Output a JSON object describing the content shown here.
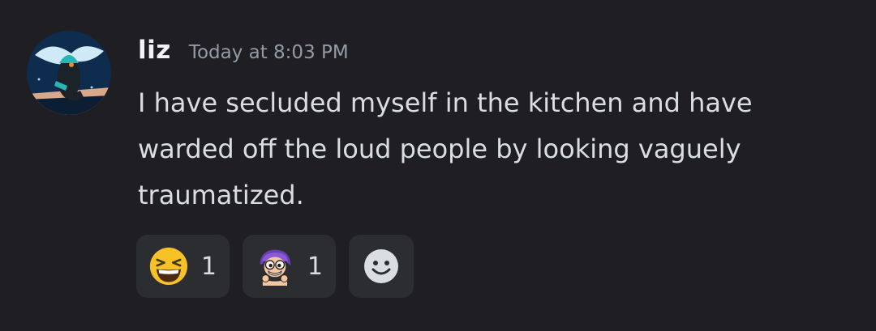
{
  "message": {
    "author": "liz",
    "timestamp": "Today at 8:03 PM",
    "lines": [
      "I have secluded myself in the kitchen and have",
      "warded off the loud people by looking vaguely",
      "traumatized."
    ]
  },
  "reactions": [
    {
      "emoji": "laughing-emoji-icon",
      "count": "1"
    },
    {
      "emoji": "custom-purple-hair-character-emoji-icon",
      "count": "1"
    }
  ],
  "add_reaction": {
    "icon": "add-reaction-smiley-icon"
  },
  "colors": {
    "background": "#1e1e23",
    "reaction_pill": "#2b2d31",
    "username": "#f2f3f5",
    "timestamp": "#949ba4",
    "text": "#dbdee1"
  }
}
